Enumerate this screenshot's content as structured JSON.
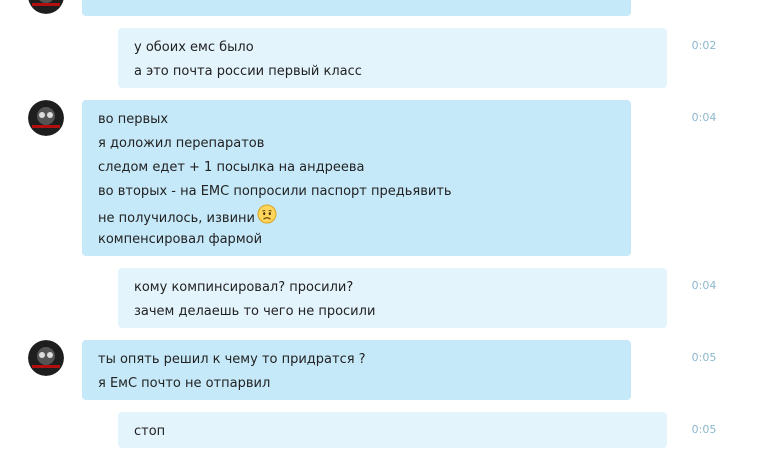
{
  "messages": [
    {
      "direction": "incoming",
      "lines": [],
      "time": ""
    },
    {
      "direction": "outgoing",
      "lines": [
        "у обоих емс было",
        "а это почта россии первый класс"
      ],
      "time": "0:02"
    },
    {
      "direction": "incoming",
      "lines": [
        "во первых",
        "я доложил перепаратов",
        "следом едет + 1 посылка на андреева",
        "во вторых - на ЕМС попросили паспорт предьявить",
        "не получилось, извини",
        "компенсировал фармой"
      ],
      "time": "0:04",
      "emoji": "worried-face-icon"
    },
    {
      "direction": "outgoing",
      "lines": [
        "кому компинсировал? просили?",
        "зачем делаешь то чего не просили"
      ],
      "time": "0:04"
    },
    {
      "direction": "incoming",
      "lines": [
        "ты опять решил к чему то придратся ?",
        "я ЕмС почто не отпарвил"
      ],
      "time": "0:05"
    },
    {
      "direction": "outgoing",
      "lines": [
        "стоп"
      ],
      "time": "0:05"
    }
  ],
  "colors": {
    "incoming_bubble": "#c6e9f9",
    "outgoing_bubble": "#e4f4fc",
    "timestamp": "#8cb7cc"
  }
}
